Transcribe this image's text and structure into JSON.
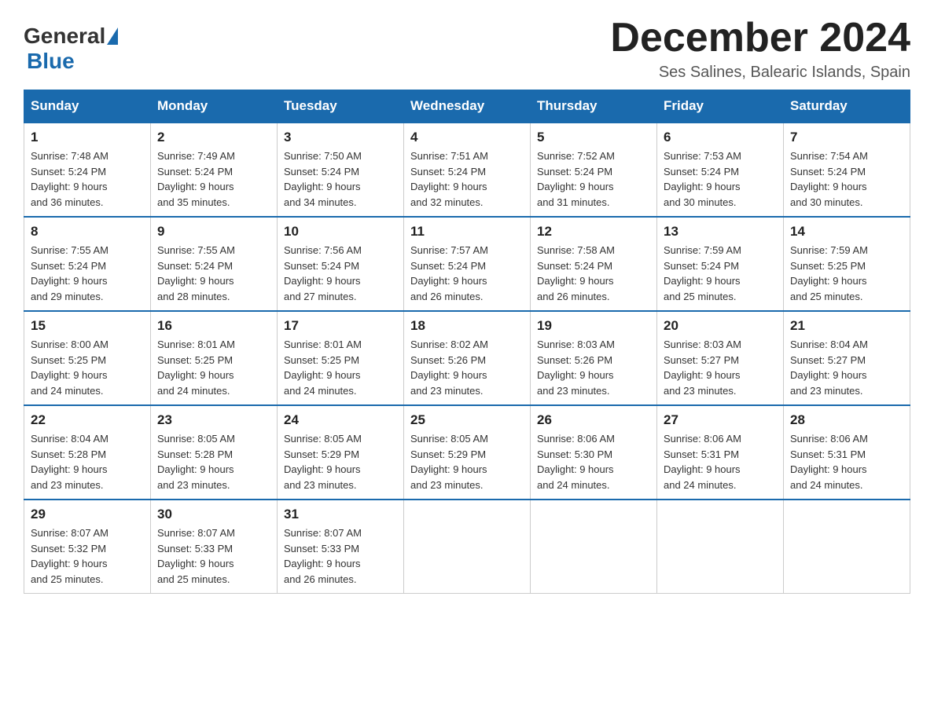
{
  "logo": {
    "general": "General",
    "blue": "Blue"
  },
  "header": {
    "month": "December 2024",
    "location": "Ses Salines, Balearic Islands, Spain"
  },
  "days_of_week": [
    "Sunday",
    "Monday",
    "Tuesday",
    "Wednesday",
    "Thursday",
    "Friday",
    "Saturday"
  ],
  "weeks": [
    [
      {
        "day": "1",
        "sunrise": "7:48 AM",
        "sunset": "5:24 PM",
        "daylight": "9 hours and 36 minutes."
      },
      {
        "day": "2",
        "sunrise": "7:49 AM",
        "sunset": "5:24 PM",
        "daylight": "9 hours and 35 minutes."
      },
      {
        "day": "3",
        "sunrise": "7:50 AM",
        "sunset": "5:24 PM",
        "daylight": "9 hours and 34 minutes."
      },
      {
        "day": "4",
        "sunrise": "7:51 AM",
        "sunset": "5:24 PM",
        "daylight": "9 hours and 32 minutes."
      },
      {
        "day": "5",
        "sunrise": "7:52 AM",
        "sunset": "5:24 PM",
        "daylight": "9 hours and 31 minutes."
      },
      {
        "day": "6",
        "sunrise": "7:53 AM",
        "sunset": "5:24 PM",
        "daylight": "9 hours and 30 minutes."
      },
      {
        "day": "7",
        "sunrise": "7:54 AM",
        "sunset": "5:24 PM",
        "daylight": "9 hours and 30 minutes."
      }
    ],
    [
      {
        "day": "8",
        "sunrise": "7:55 AM",
        "sunset": "5:24 PM",
        "daylight": "9 hours and 29 minutes."
      },
      {
        "day": "9",
        "sunrise": "7:55 AM",
        "sunset": "5:24 PM",
        "daylight": "9 hours and 28 minutes."
      },
      {
        "day": "10",
        "sunrise": "7:56 AM",
        "sunset": "5:24 PM",
        "daylight": "9 hours and 27 minutes."
      },
      {
        "day": "11",
        "sunrise": "7:57 AM",
        "sunset": "5:24 PM",
        "daylight": "9 hours and 26 minutes."
      },
      {
        "day": "12",
        "sunrise": "7:58 AM",
        "sunset": "5:24 PM",
        "daylight": "9 hours and 26 minutes."
      },
      {
        "day": "13",
        "sunrise": "7:59 AM",
        "sunset": "5:24 PM",
        "daylight": "9 hours and 25 minutes."
      },
      {
        "day": "14",
        "sunrise": "7:59 AM",
        "sunset": "5:25 PM",
        "daylight": "9 hours and 25 minutes."
      }
    ],
    [
      {
        "day": "15",
        "sunrise": "8:00 AM",
        "sunset": "5:25 PM",
        "daylight": "9 hours and 24 minutes."
      },
      {
        "day": "16",
        "sunrise": "8:01 AM",
        "sunset": "5:25 PM",
        "daylight": "9 hours and 24 minutes."
      },
      {
        "day": "17",
        "sunrise": "8:01 AM",
        "sunset": "5:25 PM",
        "daylight": "9 hours and 24 minutes."
      },
      {
        "day": "18",
        "sunrise": "8:02 AM",
        "sunset": "5:26 PM",
        "daylight": "9 hours and 23 minutes."
      },
      {
        "day": "19",
        "sunrise": "8:03 AM",
        "sunset": "5:26 PM",
        "daylight": "9 hours and 23 minutes."
      },
      {
        "day": "20",
        "sunrise": "8:03 AM",
        "sunset": "5:27 PM",
        "daylight": "9 hours and 23 minutes."
      },
      {
        "day": "21",
        "sunrise": "8:04 AM",
        "sunset": "5:27 PM",
        "daylight": "9 hours and 23 minutes."
      }
    ],
    [
      {
        "day": "22",
        "sunrise": "8:04 AM",
        "sunset": "5:28 PM",
        "daylight": "9 hours and 23 minutes."
      },
      {
        "day": "23",
        "sunrise": "8:05 AM",
        "sunset": "5:28 PM",
        "daylight": "9 hours and 23 minutes."
      },
      {
        "day": "24",
        "sunrise": "8:05 AM",
        "sunset": "5:29 PM",
        "daylight": "9 hours and 23 minutes."
      },
      {
        "day": "25",
        "sunrise": "8:05 AM",
        "sunset": "5:29 PM",
        "daylight": "9 hours and 23 minutes."
      },
      {
        "day": "26",
        "sunrise": "8:06 AM",
        "sunset": "5:30 PM",
        "daylight": "9 hours and 24 minutes."
      },
      {
        "day": "27",
        "sunrise": "8:06 AM",
        "sunset": "5:31 PM",
        "daylight": "9 hours and 24 minutes."
      },
      {
        "day": "28",
        "sunrise": "8:06 AM",
        "sunset": "5:31 PM",
        "daylight": "9 hours and 24 minutes."
      }
    ],
    [
      {
        "day": "29",
        "sunrise": "8:07 AM",
        "sunset": "5:32 PM",
        "daylight": "9 hours and 25 minutes."
      },
      {
        "day": "30",
        "sunrise": "8:07 AM",
        "sunset": "5:33 PM",
        "daylight": "9 hours and 25 minutes."
      },
      {
        "day": "31",
        "sunrise": "8:07 AM",
        "sunset": "5:33 PM",
        "daylight": "9 hours and 26 minutes."
      },
      null,
      null,
      null,
      null
    ]
  ]
}
